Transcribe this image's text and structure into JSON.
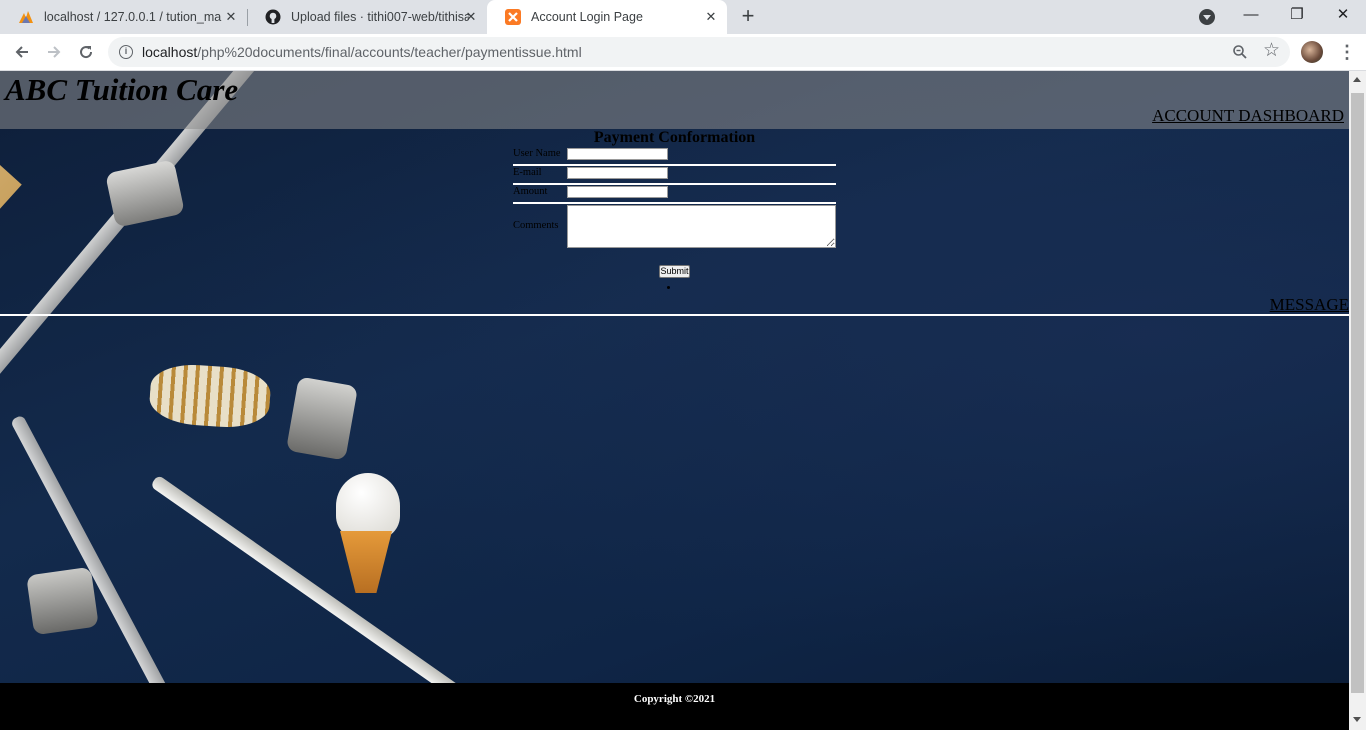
{
  "browser": {
    "tabs": [
      {
        "title": "localhost / 127.0.0.1 / tution_mar",
        "favicon": "phpmyadmin-icon"
      },
      {
        "title": "Upload files · tithi007-web/tithisa",
        "favicon": "github-icon"
      },
      {
        "title": "Account Login Page",
        "favicon": "xampp-icon",
        "active": true
      }
    ],
    "new_tab_label": "+",
    "url_host": "localhost",
    "url_path": "/php%20documents/final/accounts/teacher/paymentissue.html",
    "window_controls": {
      "minimize": "—",
      "restore": "❐",
      "close": "✕"
    }
  },
  "page": {
    "site_title": "ABC Tuition Care",
    "dashboard_link": "ACCOUNT DASHBOARD",
    "form": {
      "title": "Payment Conformation",
      "fields": {
        "username_label": "User Name",
        "email_label": "E-mail",
        "amount_label": "Amount",
        "comments_label": "Comments"
      },
      "submit_label": "Submit"
    },
    "message_link": "MESSAGE",
    "footer": {
      "copyright": "Copyright ©2021"
    }
  },
  "colors": {
    "header_band": "#8c8c8c",
    "background": "#132a4c",
    "footer": "#000000"
  }
}
